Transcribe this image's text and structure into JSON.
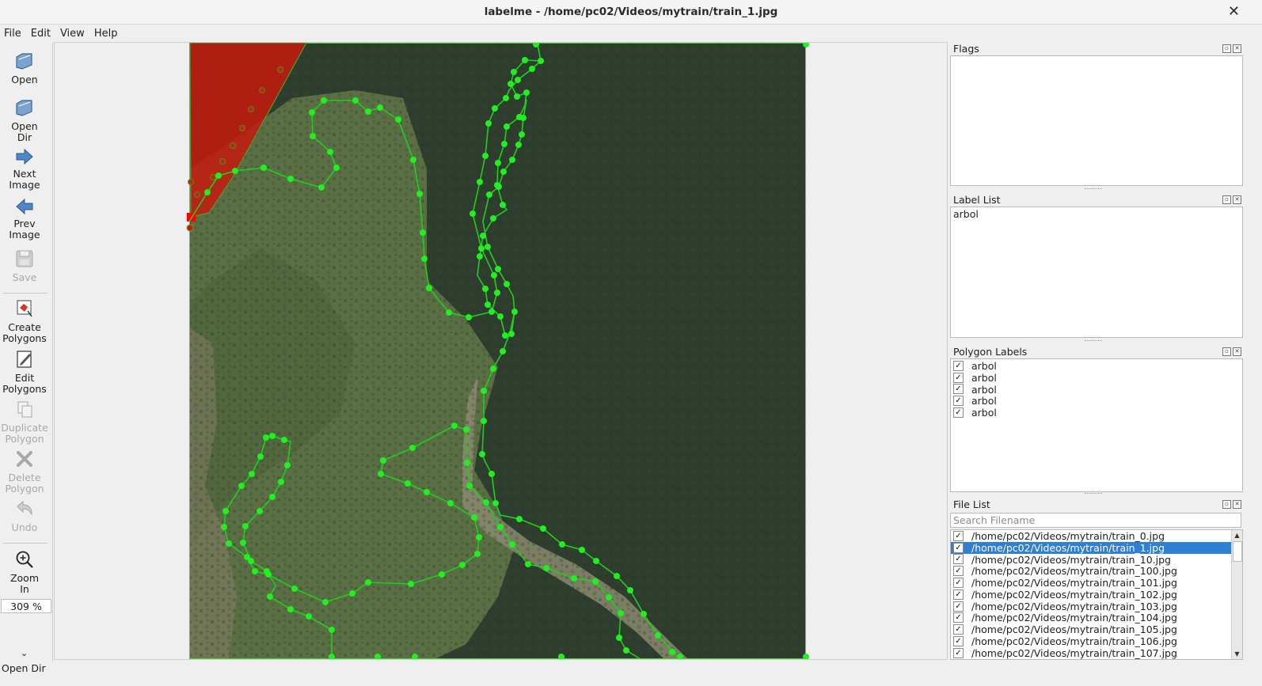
{
  "window": {
    "title": "labelme - /home/pc02/Videos/mytrain/train_1.jpg",
    "close_glyph": "✕"
  },
  "menu": [
    "File",
    "Edit",
    "View",
    "Help"
  ],
  "toolbar": {
    "open": "Open",
    "open_dir": [
      "Open",
      "Dir"
    ],
    "next_image": [
      "Next",
      "Image"
    ],
    "prev_image": [
      "Prev",
      "Image"
    ],
    "save": "Save",
    "create_polygons": [
      "Create",
      "Polygons"
    ],
    "edit_polygons": [
      "Edit",
      "Polygons"
    ],
    "duplicate_polygon": [
      "Duplicate",
      "Polygon"
    ],
    "delete_polygon": [
      "Delete",
      "Polygon"
    ],
    "undo": "Undo",
    "zoom_in": [
      "Zoom",
      "In"
    ],
    "zoom_value": "309 %",
    "more": "⌄"
  },
  "status": "Open Dir",
  "docks": {
    "flags": {
      "title": "Flags"
    },
    "label_list": {
      "title": "Label List",
      "items": [
        "arbol"
      ]
    },
    "polygon_labels": {
      "title": "Polygon Labels",
      "items": [
        "arbol",
        "arbol",
        "arbol",
        "arbol",
        "arbol"
      ]
    },
    "file_list": {
      "title": "File List",
      "search_placeholder": "Search Filename",
      "selected_index": 1,
      "files": [
        "/home/pc02/Videos/mytrain/train_0.jpg",
        "/home/pc02/Videos/mytrain/train_1.jpg",
        "/home/pc02/Videos/mytrain/train_10.jpg",
        "/home/pc02/Videos/mytrain/train_100.jpg",
        "/home/pc02/Videos/mytrain/train_101.jpg",
        "/home/pc02/Videos/mytrain/train_102.jpg",
        "/home/pc02/Videos/mytrain/train_103.jpg",
        "/home/pc02/Videos/mytrain/train_104.jpg",
        "/home/pc02/Videos/mytrain/train_105.jpg",
        "/home/pc02/Videos/mytrain/train_106.jpg",
        "/home/pc02/Videos/mytrain/train_107.jpg"
      ]
    }
  },
  "colors": {
    "polygon": "#00ff00",
    "selected_polygon": "#cc1100",
    "forest_dark": "#2c3b2c",
    "field_light": "#5d7246",
    "selection": "#2f7fd4"
  },
  "icons": [
    "open-folder-icon",
    "open-dir-icon",
    "next-arrow-icon",
    "prev-arrow-icon",
    "save-disk-icon",
    "create-polygon-icon",
    "edit-polygon-icon",
    "duplicate-icon",
    "delete-x-icon",
    "undo-icon",
    "zoom-in-icon"
  ]
}
